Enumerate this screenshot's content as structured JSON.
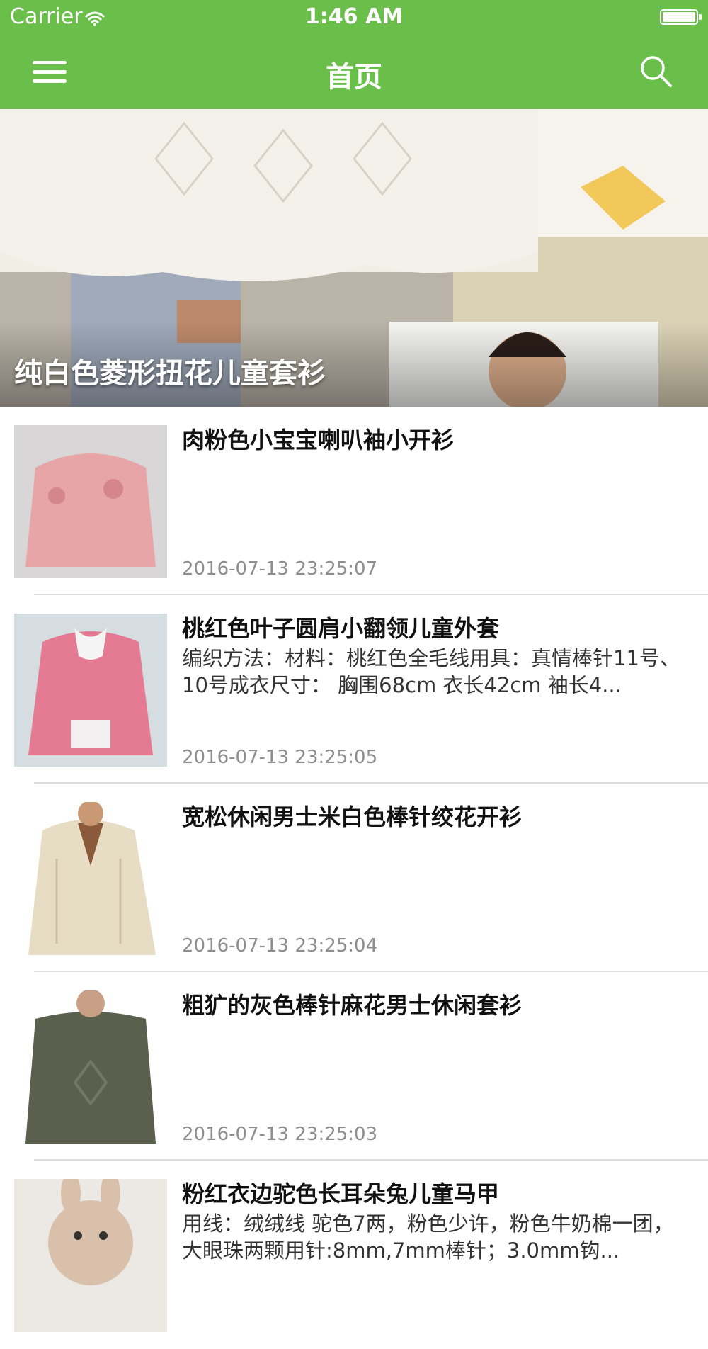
{
  "status_bar": {
    "carrier": "Carrier",
    "time": "1:46 AM"
  },
  "nav": {
    "title": "首页",
    "menu_icon": "hamburger-menu-icon",
    "search_icon": "search-icon",
    "background": "#6abf4b"
  },
  "banner": {
    "caption": "纯白色菱形扭花儿童套衫"
  },
  "articles": [
    {
      "title": "肉粉色小宝宝喇叭袖小开衫",
      "desc": "",
      "date": "2016-07-13 23:25:07",
      "thumb_color": "#e8a5a8"
    },
    {
      "title": "桃红色叶子圆肩小翻领儿童外套",
      "desc": "编织方法：材料：桃红色全毛线用具：真情棒针11号、10号成衣尺寸： 胸围68cm 衣长42cm 袖长4...",
      "date": "2016-07-13 23:25:05",
      "thumb_color": "#e57a93"
    },
    {
      "title": "宽松休闲男士米白色棒针绞花开衫",
      "desc": "",
      "date": "2016-07-13 23:25:04",
      "thumb_color": "#e7dcc4"
    },
    {
      "title": "粗犷的灰色棒针麻花男士休闲套衫",
      "desc": "",
      "date": "2016-07-13 23:25:03",
      "thumb_color": "#5b5f4e"
    },
    {
      "title": "粉红衣边驼色长耳朵兔儿童马甲",
      "desc": "用线：绒绒线 驼色7两，粉色少许，粉色牛奶棉一团，大眼珠两颗用针:8mm,7mm棒针；3.0mm钩...",
      "date": "",
      "thumb_color": "#d8c0ab"
    }
  ]
}
